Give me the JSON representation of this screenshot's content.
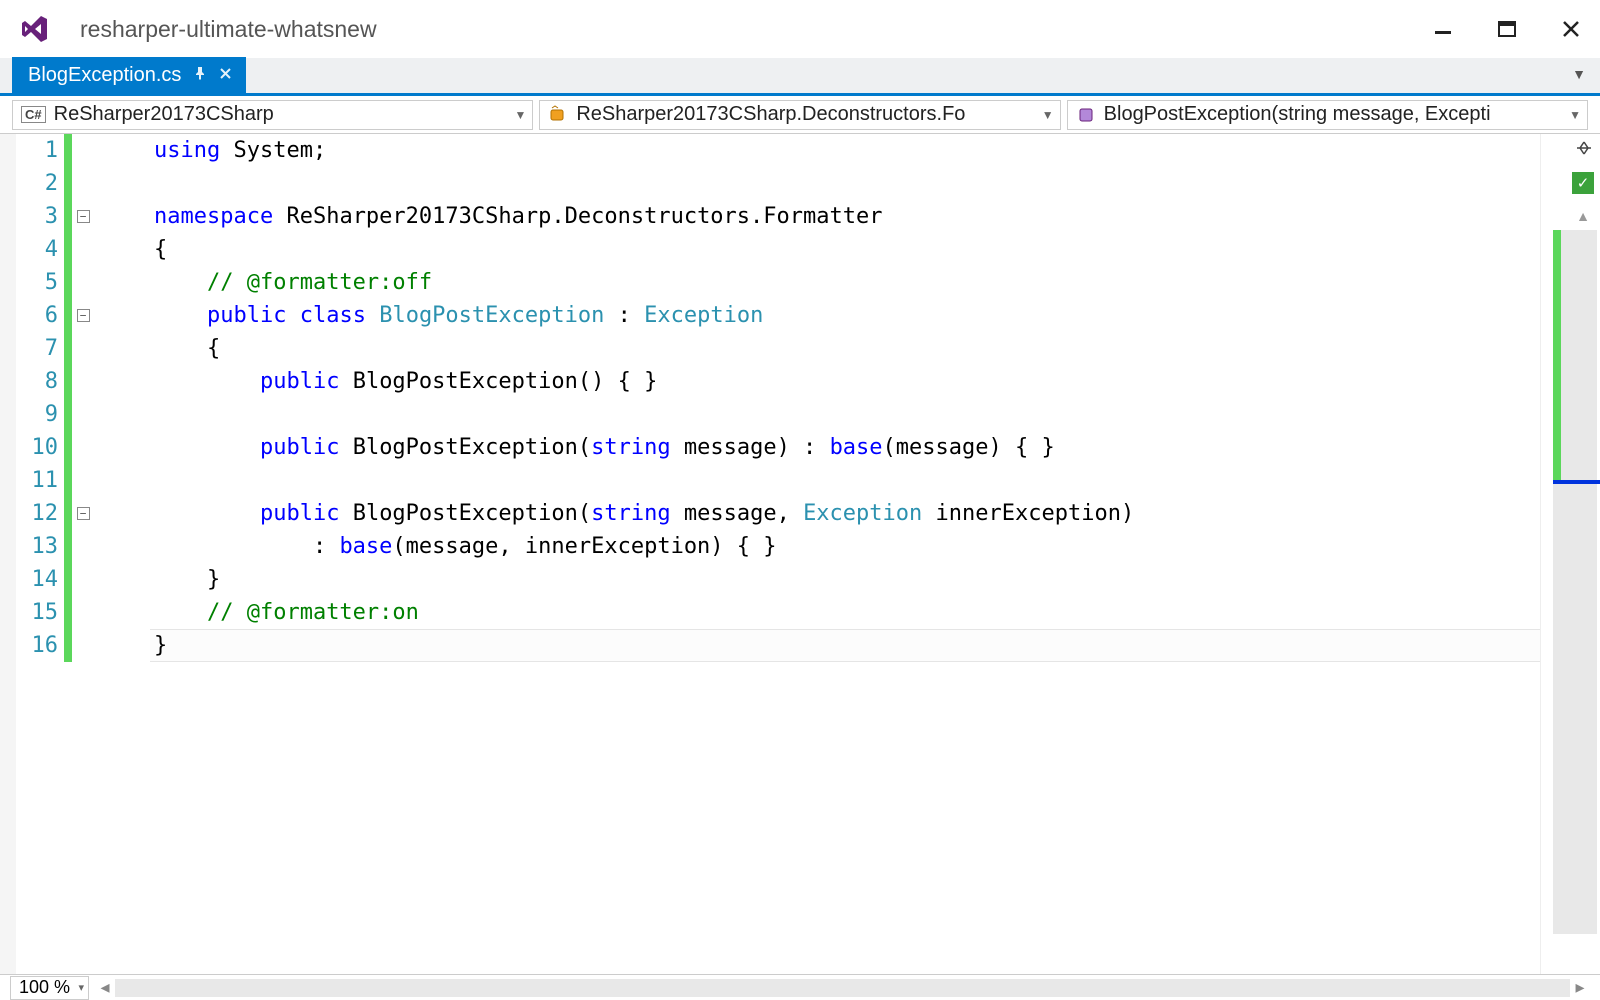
{
  "window": {
    "title": "resharper-ultimate-whatsnew"
  },
  "tab": {
    "label": "BlogException.cs"
  },
  "nav": {
    "project": "ReSharper20173CSharp",
    "class": "ReSharper20173CSharp.Deconstructors.Fo",
    "member": "BlogPostException(string message, Excepti"
  },
  "status": {
    "zoom": "100 %"
  },
  "code": {
    "lines": [
      {
        "n": "1",
        "fold": "",
        "html": "<span class='k'>using</span> System;"
      },
      {
        "n": "2",
        "fold": "|",
        "html": ""
      },
      {
        "n": "3",
        "fold": "box",
        "html": "<span class='k'>namespace</span> ReSharper20173CSharp.Deconstructors.Formatter"
      },
      {
        "n": "4",
        "fold": "|",
        "html": "{"
      },
      {
        "n": "5",
        "fold": "|",
        "html": "    <span class='cm'>// @formatter:off</span>"
      },
      {
        "n": "6",
        "fold": "box",
        "html": "    <span class='k'>public</span> <span class='k'>class</span> <span class='t'>BlogPostException</span> : <span class='t'>Exception</span>"
      },
      {
        "n": "7",
        "fold": "|",
        "html": "    {"
      },
      {
        "n": "8",
        "fold": "|",
        "html": "        <span class='k'>public</span> BlogPostException() { }"
      },
      {
        "n": "9",
        "fold": "|",
        "html": ""
      },
      {
        "n": "10",
        "fold": "|",
        "html": "        <span class='k'>public</span> BlogPostException(<span class='k'>string</span> message) : <span class='k'>base</span>(message) { }"
      },
      {
        "n": "11",
        "fold": "|",
        "html": ""
      },
      {
        "n": "12",
        "fold": "box",
        "html": "        <span class='k'>public</span> BlogPostException(<span class='k'>string</span> message, <span class='t'>Exception</span> innerException)"
      },
      {
        "n": "13",
        "fold": "|",
        "html": "            : <span class='k'>base</span>(message, innerException) { }"
      },
      {
        "n": "14",
        "fold": "|",
        "html": "    }"
      },
      {
        "n": "15",
        "fold": "|",
        "html": "    <span class='cm'>// @formatter:on</span>"
      },
      {
        "n": "16",
        "fold": "|",
        "html": "}"
      }
    ]
  }
}
